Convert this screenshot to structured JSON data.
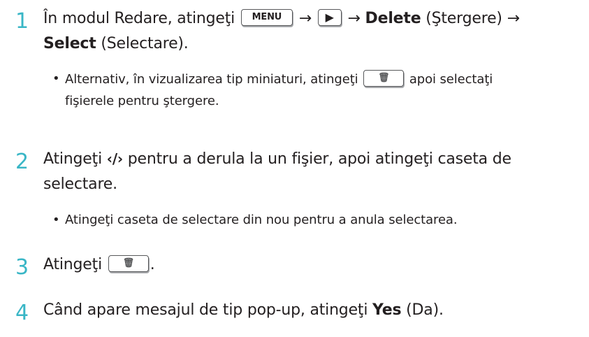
{
  "steps": [
    {
      "number": "1",
      "line1": {
        "prefix": "În modul Redare, atingeţi",
        "menu_button": "MENU",
        "arrow1": "→",
        "play_icon_glyph": "▶",
        "arrow2": "→",
        "delete_bold": "Delete",
        "delete_paren": "(Ştergere) →"
      },
      "line2": {
        "select_bold": "Select",
        "select_paren": "(Selectare)."
      },
      "bullet": {
        "dot": "•",
        "line1_prefix": "Alternativ, în vizualizarea tip miniaturi, atingeţi",
        "trash_icon_glyph": "🗑",
        "line1_suffix": "apoi selectaţi",
        "line2": "fişierele pentru ştergere."
      }
    },
    {
      "number": "2",
      "line1_prefix": "Atingeţi",
      "nav_arrows_glyph": "‹/›",
      "line1_suffix": "pentru a derula la un fişier, apoi atingeţi caseta de",
      "line2": "selectare.",
      "bullet": {
        "dot": "•",
        "text": "Atingeţi caseta de selectare din nou pentru a anula selectarea."
      }
    },
    {
      "number": "3",
      "prefix": "Atingeţi",
      "trash_icon_glyph": "🗑",
      "suffix": "."
    },
    {
      "number": "4",
      "prefix": "Când apare mesajul de tip pop-up, atingeţi",
      "yes_bold": "Yes",
      "yes_paren": "(Da)."
    }
  ],
  "icons": {
    "menu_button": "menu-button-icon",
    "play": "play-icon",
    "trash": "trash-icon",
    "nav_arrows": "left-right-arrows-icon"
  },
  "colors": {
    "step_number": "#39b6c6",
    "text": "#231f20"
  }
}
